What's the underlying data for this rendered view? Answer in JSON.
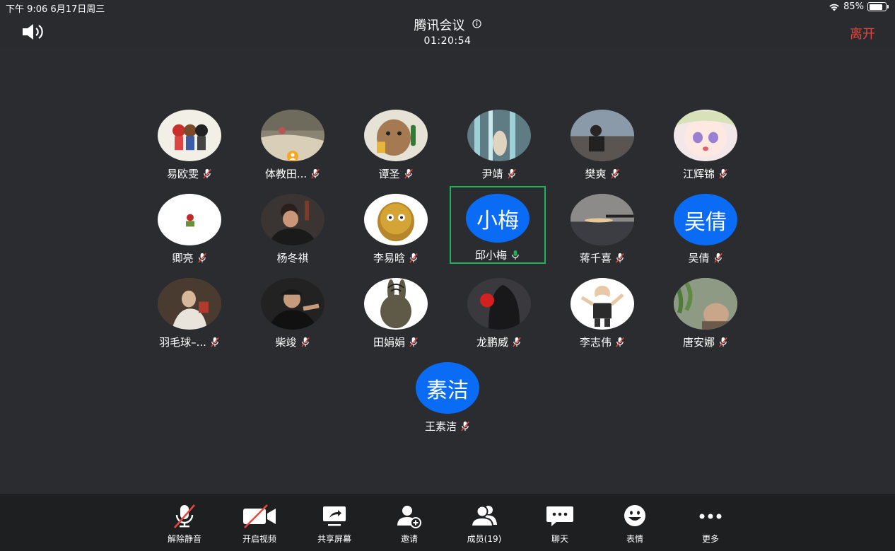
{
  "status_bar": {
    "time": "下午 9:06   6月17日周三",
    "battery": "85%",
    "battery_level": 0.85
  },
  "header": {
    "title": "腾讯会议",
    "timer": "01:20:54",
    "leave_label": "离开",
    "icons": {
      "speaker": "speaker-icon",
      "info": "info-icon"
    }
  },
  "participants": [
    {
      "name": "易欧雯",
      "mic": "muted",
      "avatar": "photo"
    },
    {
      "name": "体教田...",
      "mic": "muted",
      "avatar": "photo",
      "host": true
    },
    {
      "name": "谭圣",
      "mic": "muted",
      "avatar": "photo"
    },
    {
      "name": "尹靖",
      "mic": "muted",
      "avatar": "photo"
    },
    {
      "name": "樊爽",
      "mic": "muted",
      "avatar": "photo"
    },
    {
      "name": "江辉锦",
      "mic": "muted",
      "avatar": "photo"
    },
    {
      "name": "卿亮",
      "mic": "muted",
      "avatar": "photo"
    },
    {
      "name": "杨冬祺",
      "mic": "none",
      "avatar": "photo"
    },
    {
      "name": "李易晗",
      "mic": "muted",
      "avatar": "photo"
    },
    {
      "name": "邱小梅",
      "mic": "on",
      "avatar": "text",
      "avatar_text": "小梅",
      "active": true
    },
    {
      "name": "蒋千喜",
      "mic": "muted",
      "avatar": "photo"
    },
    {
      "name": "吴倩",
      "mic": "muted",
      "avatar": "text",
      "avatar_text": "吴倩"
    },
    {
      "name": "羽毛球–...",
      "mic": "muted",
      "avatar": "photo"
    },
    {
      "name": "柴竣",
      "mic": "muted",
      "avatar": "photo"
    },
    {
      "name": "田娟娟",
      "mic": "muted",
      "avatar": "photo"
    },
    {
      "name": "龙鹏威",
      "mic": "muted",
      "avatar": "photo"
    },
    {
      "name": "李志伟",
      "mic": "muted",
      "avatar": "photo"
    },
    {
      "name": "唐安娜",
      "mic": "muted",
      "avatar": "photo"
    },
    {
      "name": "王素洁",
      "mic": "muted",
      "avatar": "text",
      "avatar_text": "素洁"
    }
  ],
  "toolbar": {
    "unmute": "解除静音",
    "start_video": "开启视频",
    "share_screen": "共享屏幕",
    "invite": "邀请",
    "members": "成员(19)",
    "chat": "聊天",
    "reactions": "表情",
    "more": "更多"
  },
  "colors": {
    "background": "#2b2c2f",
    "toolbar": "#1e1f21",
    "avatar_blue": "#0a6cf5",
    "leave_red": "#e5473f",
    "active_speaker": "#1fb25a"
  }
}
